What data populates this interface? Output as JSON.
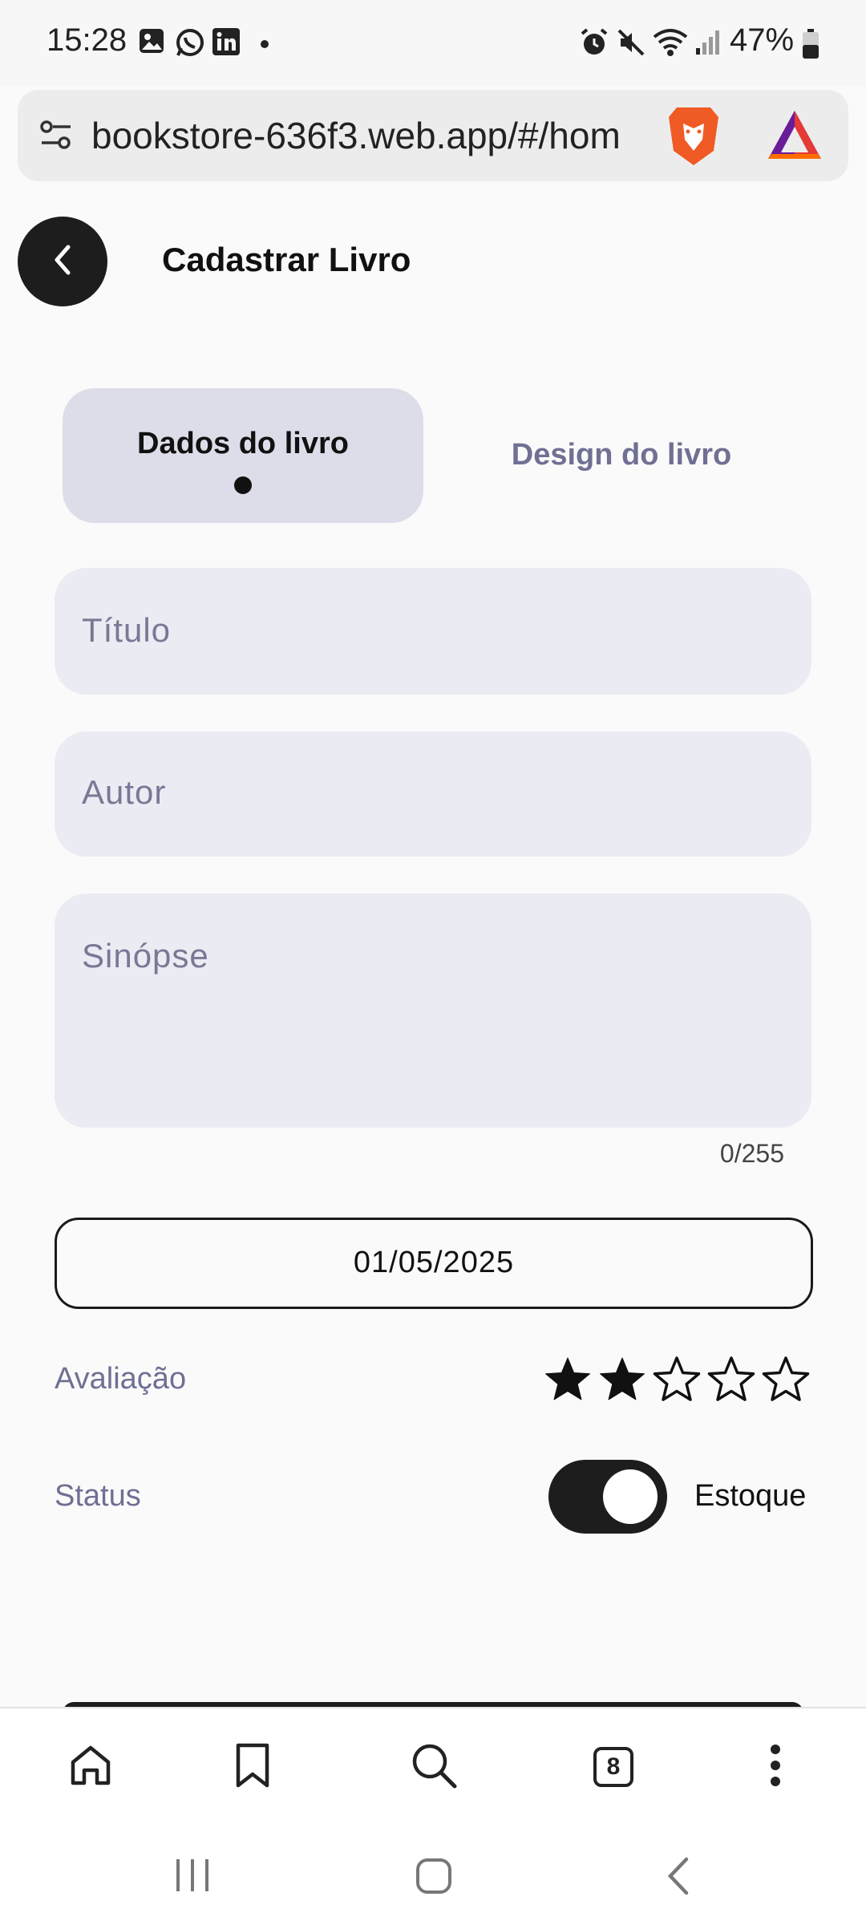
{
  "status_bar": {
    "time": "15:28",
    "battery": "47%"
  },
  "browser": {
    "url": "bookstore-636f3.web.app/#/hom",
    "tabs_count": "8"
  },
  "header": {
    "title": "Cadastrar Livro"
  },
  "tabs": [
    {
      "label": "Dados do livro",
      "selected": true
    },
    {
      "label": "Design do livro",
      "selected": false
    }
  ],
  "form": {
    "titulo_placeholder": "Título",
    "autor_placeholder": "Autor",
    "sinopse_placeholder": "Sinópse",
    "sinopse_counter": "0/255",
    "date_value": "01/05/2025",
    "rating_label": "Avaliação",
    "rating_value": 2,
    "rating_max": 5,
    "status_label": "Status",
    "status_value": "Estoque",
    "status_on": true
  },
  "colors": {
    "accent_dark": "#1d1d1d",
    "field_bg": "#ebebf3",
    "tab_selected_bg": "#dcdde9",
    "muted_text": "#6f7094"
  }
}
